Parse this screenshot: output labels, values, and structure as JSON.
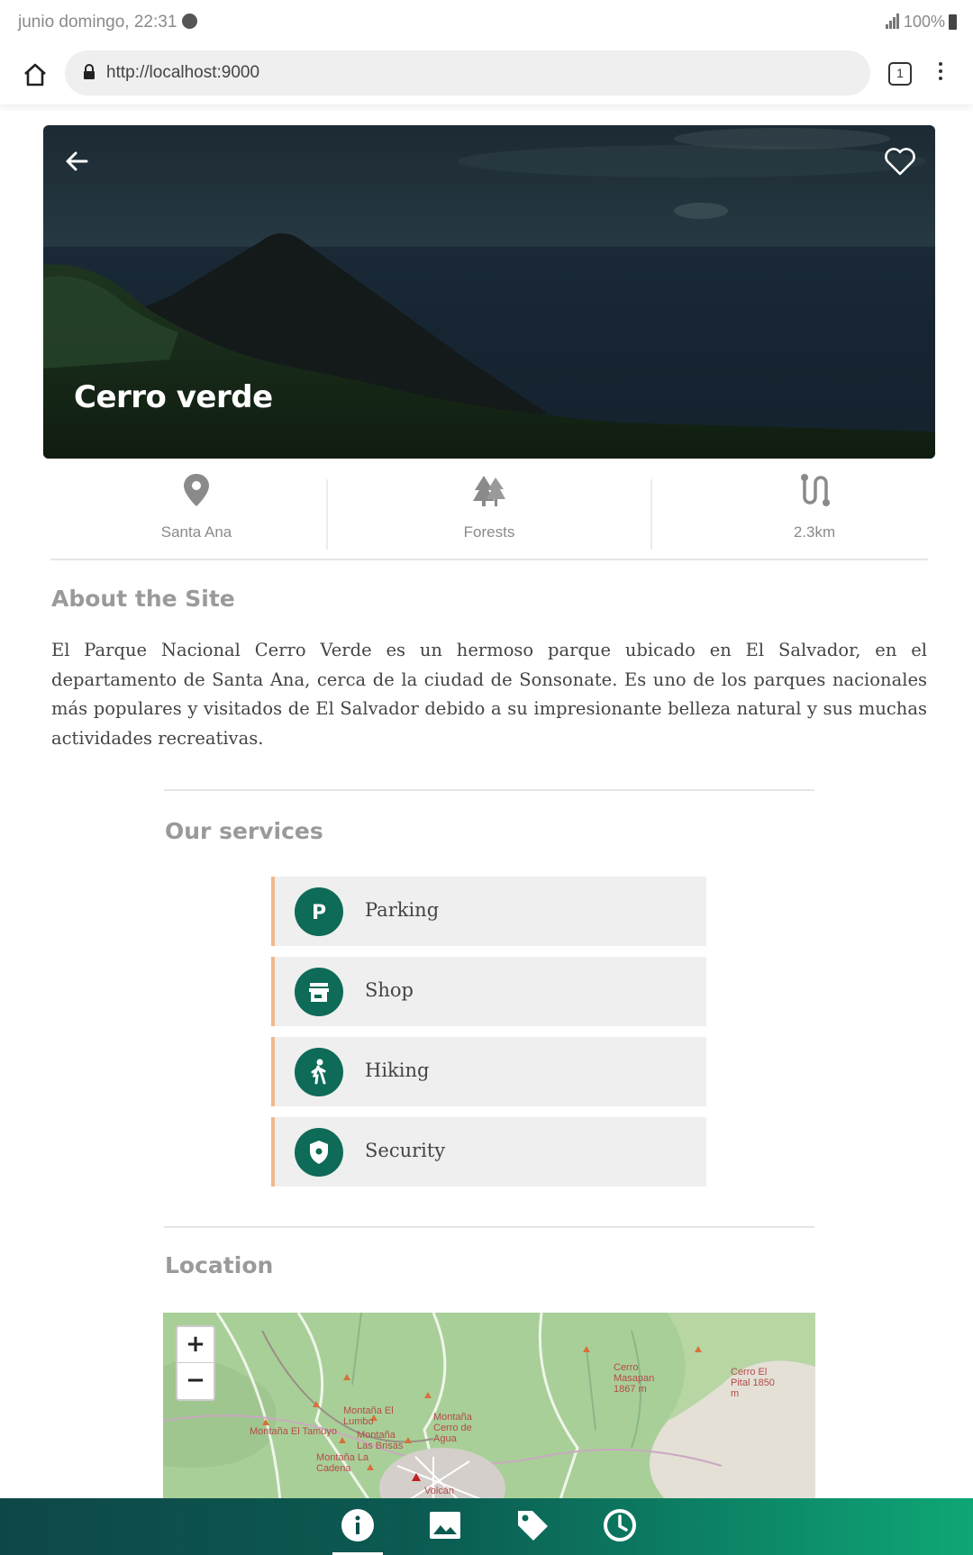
{
  "status_bar": {
    "time_text": "junio domingo, 22:31",
    "battery_text": "100%"
  },
  "browser": {
    "url": "http://localhost:9000",
    "tab_count": "1"
  },
  "hero": {
    "title": "Cerro verde"
  },
  "info": [
    {
      "icon": "map-pin-icon",
      "label": "Santa Ana"
    },
    {
      "icon": "forest-trees-icon",
      "label": "Forests"
    },
    {
      "icon": "route-icon",
      "label": "2.3km"
    }
  ],
  "about": {
    "heading": "About the Site",
    "text": "El Parque Nacional Cerro Verde es un hermoso parque ubicado en El Salvador, en el departamento de Santa Ana, cerca de la ciudad de Sonsonate. Es uno de los parques nacionales más populares y visitados de El Salvador debido a su impresionante belleza natural y sus muchas actividades recreativas."
  },
  "services": {
    "heading": "Our services",
    "items": [
      {
        "icon": "parking-icon",
        "label": "Parking"
      },
      {
        "icon": "shop-icon",
        "label": "Shop"
      },
      {
        "icon": "hiking-icon",
        "label": "Hiking"
      },
      {
        "icon": "security-shield-icon",
        "label": "Security"
      }
    ]
  },
  "location": {
    "heading": "Location",
    "zoom_in": "+",
    "zoom_out": "−",
    "map_labels": [
      "Montaña El Tamuyo",
      "Cerro Masapan 1867 m",
      "Cerro El Pital 1850 m",
      "Montaña El Lumbo",
      "Montaña Cerro de Agua",
      "Montaña Las Brisas",
      "Montaña La Cadena",
      "Volcán"
    ]
  },
  "colors": {
    "accent": "#0d6b57",
    "service_border": "#f0b98c",
    "nav_gradient_start": "#0e4747",
    "nav_gradient_end": "#0ea676"
  },
  "bottom_nav": [
    {
      "icon": "info-icon",
      "active": true
    },
    {
      "icon": "gallery-image-icon",
      "active": false
    },
    {
      "icon": "tag-icon",
      "active": false
    },
    {
      "icon": "history-clock-icon",
      "active": false
    }
  ]
}
